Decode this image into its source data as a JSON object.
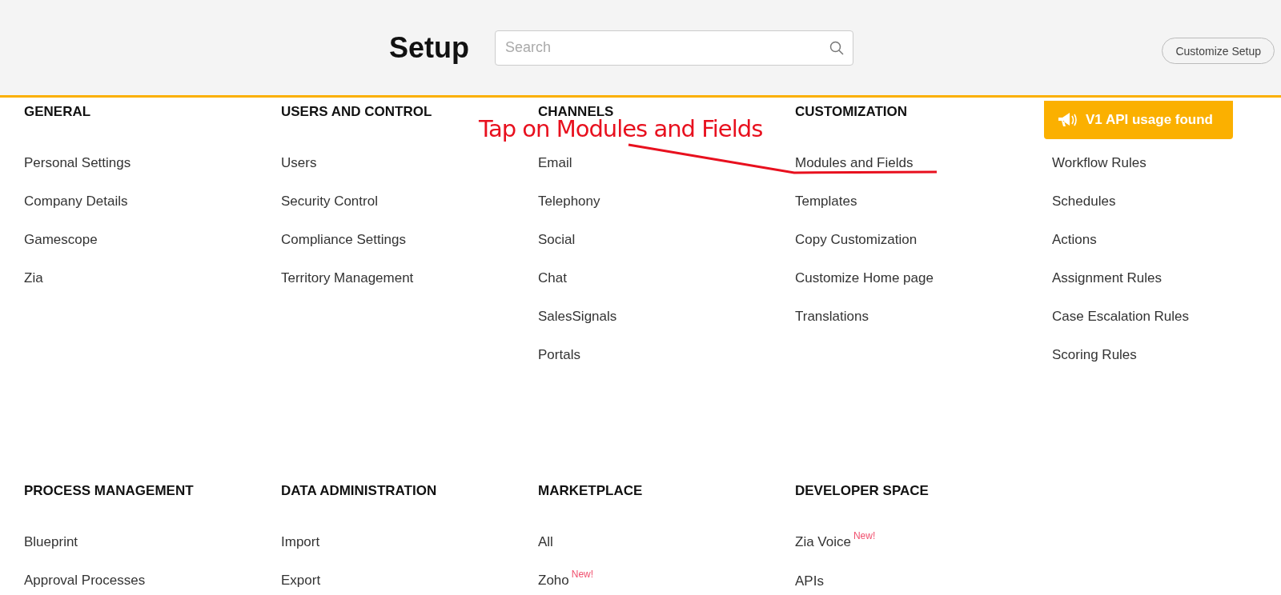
{
  "header": {
    "title": "Setup",
    "search": {
      "placeholder": "Search"
    },
    "customize_button": "Customize Setup"
  },
  "rows": [
    {
      "sections": [
        {
          "heading": "GENERAL",
          "items": [
            {
              "label": "Personal Settings"
            },
            {
              "label": "Company Details"
            },
            {
              "label": "Gamescope"
            },
            {
              "label": "Zia"
            }
          ]
        },
        {
          "heading": "USERS AND CONTROL",
          "items": [
            {
              "label": "Users"
            },
            {
              "label": "Security Control"
            },
            {
              "label": "Compliance Settings"
            },
            {
              "label": "Territory Management"
            }
          ]
        },
        {
          "heading": "CHANNELS",
          "items": [
            {
              "label": "Email"
            },
            {
              "label": "Telephony"
            },
            {
              "label": "Social"
            },
            {
              "label": "Chat"
            },
            {
              "label": "SalesSignals"
            },
            {
              "label": "Portals"
            }
          ]
        },
        {
          "heading": "CUSTOMIZATION",
          "items": [
            {
              "label": "Modules and Fields"
            },
            {
              "label": "Templates"
            },
            {
              "label": "Copy Customization"
            },
            {
              "label": "Customize Home page"
            },
            {
              "label": "Translations"
            }
          ]
        },
        {
          "banner": "V1 API usage found",
          "items": [
            {
              "label": "Workflow Rules"
            },
            {
              "label": "Schedules"
            },
            {
              "label": "Actions"
            },
            {
              "label": "Assignment Rules"
            },
            {
              "label": "Case Escalation Rules"
            },
            {
              "label": "Scoring Rules"
            }
          ]
        }
      ]
    },
    {
      "sections": [
        {
          "heading": "PROCESS MANAGEMENT",
          "items": [
            {
              "label": "Blueprint"
            },
            {
              "label": "Approval Processes"
            }
          ]
        },
        {
          "heading": "DATA ADMINISTRATION",
          "items": [
            {
              "label": "Import"
            },
            {
              "label": "Export"
            }
          ]
        },
        {
          "heading": "MARKETPLACE",
          "items": [
            {
              "label": "All"
            },
            {
              "label": "Zoho",
              "badge": "New!"
            }
          ]
        },
        {
          "heading": "DEVELOPER SPACE",
          "items": [
            {
              "label": "Zia Voice",
              "badge": "New!"
            },
            {
              "label": "APIs"
            }
          ]
        }
      ]
    }
  ],
  "annotation": {
    "text": "Tap on Modules and Fields"
  }
}
